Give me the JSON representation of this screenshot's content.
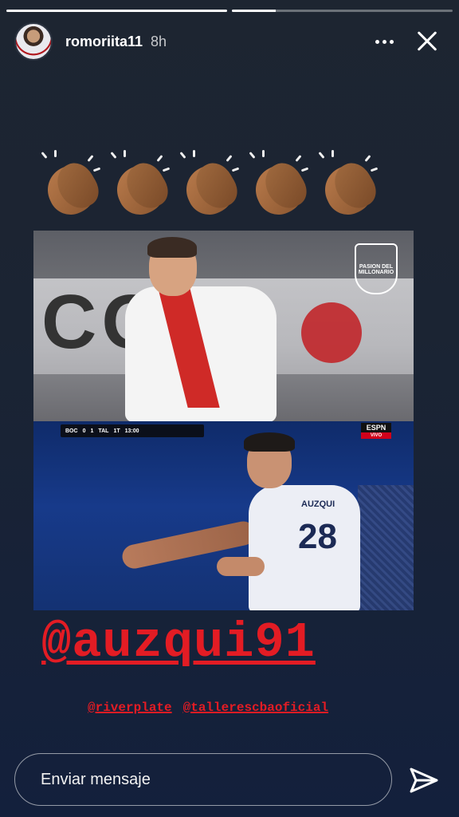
{
  "progress": [
    1.0,
    0.2
  ],
  "header": {
    "username": "romoriita11",
    "time": "8h"
  },
  "story": {
    "claps_count": 5,
    "scorebug": {
      "home": "BOC",
      "home_score": "0",
      "away_score": "1",
      "away": "TAL",
      "half": "1T",
      "clock": "13:00"
    },
    "espn_label": "ESPN",
    "espn_live": "VIVO",
    "jersey_number": "28",
    "jersey_name": "AUZQUI",
    "pasion_logo": "PASION DEL MILLONARIO",
    "mention": "@auzqui91",
    "tags": [
      "@riverplate",
      "@tallerescbaoficial"
    ]
  },
  "message_bar": {
    "placeholder": "Enviar mensaje"
  }
}
